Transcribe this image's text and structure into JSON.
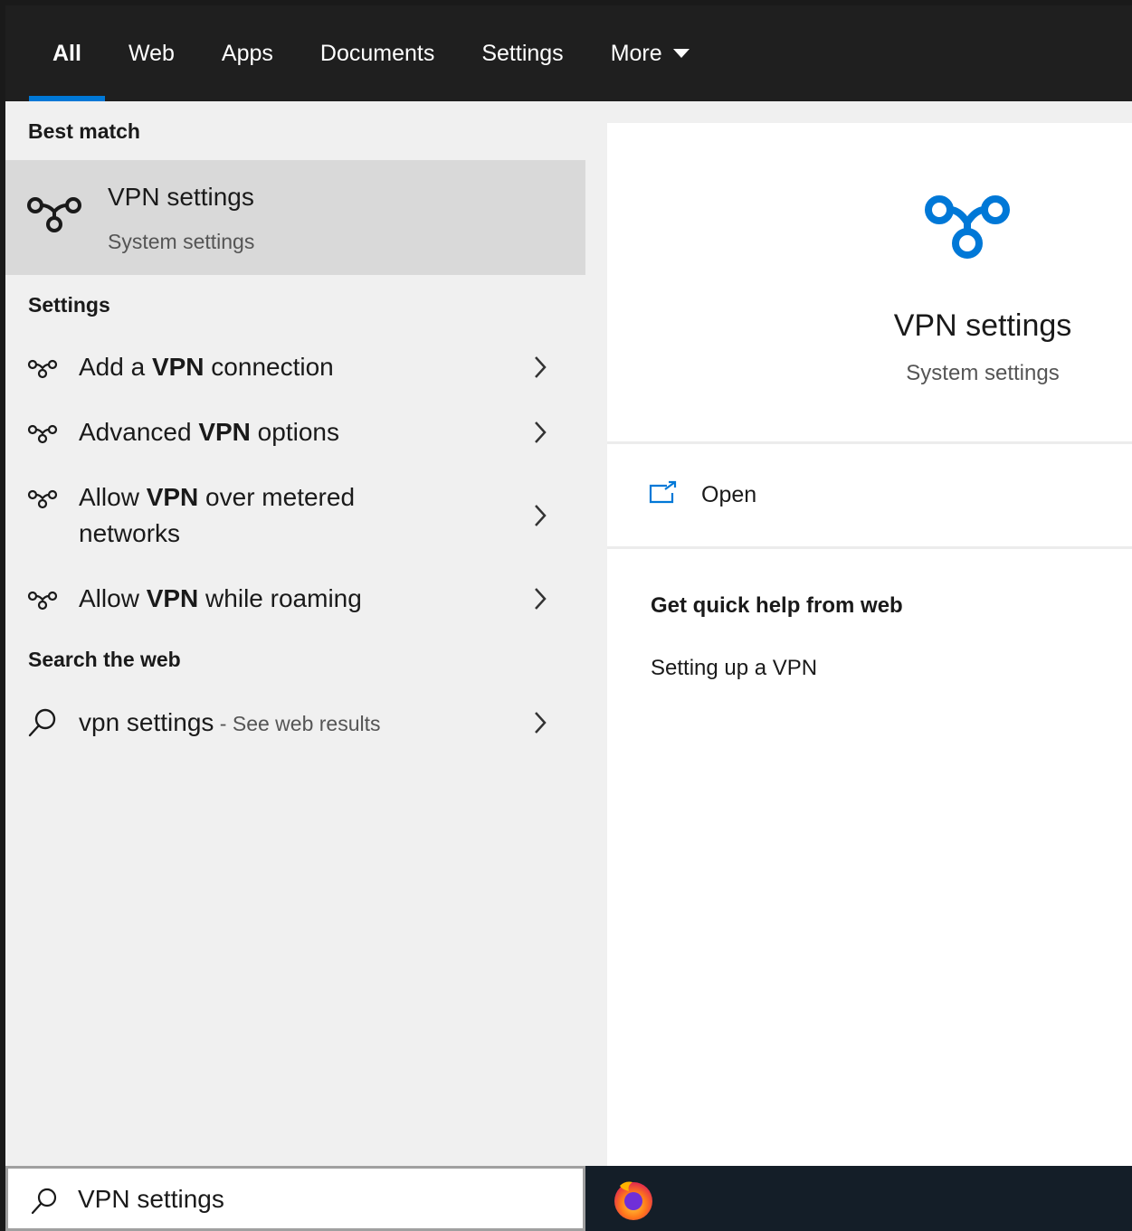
{
  "tabs": [
    {
      "label": "All",
      "active": true
    },
    {
      "label": "Web"
    },
    {
      "label": "Apps"
    },
    {
      "label": "Documents"
    },
    {
      "label": "Settings"
    },
    {
      "label": "More"
    }
  ],
  "best_match": {
    "heading": "Best match",
    "title": "VPN settings",
    "subtitle": "System settings",
    "icon": "vpn-icon"
  },
  "settings_section": {
    "heading": "Settings",
    "items": [
      {
        "before": "Add a ",
        "bold": "VPN",
        "after": " connection"
      },
      {
        "before": "Advanced ",
        "bold": "VPN",
        "after": " options"
      },
      {
        "before": "Allow ",
        "bold": "VPN",
        "after": " over metered networks"
      },
      {
        "before": "Allow ",
        "bold": "VPN",
        "after": " while roaming"
      }
    ]
  },
  "web_section": {
    "heading": "Search the web",
    "query": "vpn settings",
    "suffix": " - See web results"
  },
  "preview": {
    "title": "VPN settings",
    "subtitle": "System settings",
    "open_label": "Open",
    "help_heading": "Get quick help from web",
    "help_link": "Setting up a VPN"
  },
  "search": {
    "value": "VPN settings"
  },
  "taskbar": {
    "app_icon": "firefox-icon"
  },
  "colors": {
    "accent": "#0078d7",
    "tabbar_bg": "#1f1f1f",
    "pane_bg": "#f0f0f0",
    "selected_bg": "#d9d9d9",
    "taskbar_bg": "#141e28"
  }
}
